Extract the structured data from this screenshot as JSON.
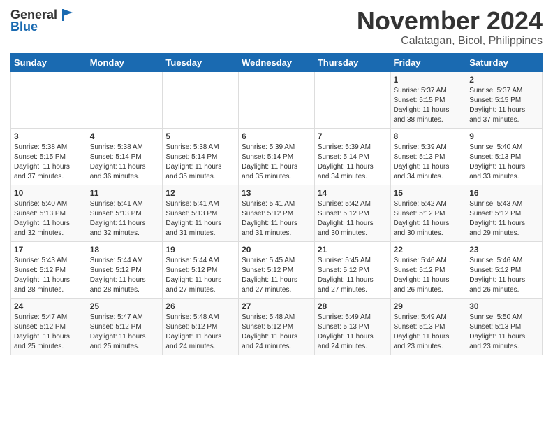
{
  "header": {
    "logo_line1": "General",
    "logo_line2": "Blue",
    "month": "November 2024",
    "location": "Calatagan, Bicol, Philippines"
  },
  "days_of_week": [
    "Sunday",
    "Monday",
    "Tuesday",
    "Wednesday",
    "Thursday",
    "Friday",
    "Saturday"
  ],
  "weeks": [
    [
      {
        "day": "",
        "info": ""
      },
      {
        "day": "",
        "info": ""
      },
      {
        "day": "",
        "info": ""
      },
      {
        "day": "",
        "info": ""
      },
      {
        "day": "",
        "info": ""
      },
      {
        "day": "1",
        "info": "Sunrise: 5:37 AM\nSunset: 5:15 PM\nDaylight: 11 hours\nand 38 minutes."
      },
      {
        "day": "2",
        "info": "Sunrise: 5:37 AM\nSunset: 5:15 PM\nDaylight: 11 hours\nand 37 minutes."
      }
    ],
    [
      {
        "day": "3",
        "info": "Sunrise: 5:38 AM\nSunset: 5:15 PM\nDaylight: 11 hours\nand 37 minutes."
      },
      {
        "day": "4",
        "info": "Sunrise: 5:38 AM\nSunset: 5:14 PM\nDaylight: 11 hours\nand 36 minutes."
      },
      {
        "day": "5",
        "info": "Sunrise: 5:38 AM\nSunset: 5:14 PM\nDaylight: 11 hours\nand 35 minutes."
      },
      {
        "day": "6",
        "info": "Sunrise: 5:39 AM\nSunset: 5:14 PM\nDaylight: 11 hours\nand 35 minutes."
      },
      {
        "day": "7",
        "info": "Sunrise: 5:39 AM\nSunset: 5:14 PM\nDaylight: 11 hours\nand 34 minutes."
      },
      {
        "day": "8",
        "info": "Sunrise: 5:39 AM\nSunset: 5:13 PM\nDaylight: 11 hours\nand 34 minutes."
      },
      {
        "day": "9",
        "info": "Sunrise: 5:40 AM\nSunset: 5:13 PM\nDaylight: 11 hours\nand 33 minutes."
      }
    ],
    [
      {
        "day": "10",
        "info": "Sunrise: 5:40 AM\nSunset: 5:13 PM\nDaylight: 11 hours\nand 32 minutes."
      },
      {
        "day": "11",
        "info": "Sunrise: 5:41 AM\nSunset: 5:13 PM\nDaylight: 11 hours\nand 32 minutes."
      },
      {
        "day": "12",
        "info": "Sunrise: 5:41 AM\nSunset: 5:13 PM\nDaylight: 11 hours\nand 31 minutes."
      },
      {
        "day": "13",
        "info": "Sunrise: 5:41 AM\nSunset: 5:12 PM\nDaylight: 11 hours\nand 31 minutes."
      },
      {
        "day": "14",
        "info": "Sunrise: 5:42 AM\nSunset: 5:12 PM\nDaylight: 11 hours\nand 30 minutes."
      },
      {
        "day": "15",
        "info": "Sunrise: 5:42 AM\nSunset: 5:12 PM\nDaylight: 11 hours\nand 30 minutes."
      },
      {
        "day": "16",
        "info": "Sunrise: 5:43 AM\nSunset: 5:12 PM\nDaylight: 11 hours\nand 29 minutes."
      }
    ],
    [
      {
        "day": "17",
        "info": "Sunrise: 5:43 AM\nSunset: 5:12 PM\nDaylight: 11 hours\nand 28 minutes."
      },
      {
        "day": "18",
        "info": "Sunrise: 5:44 AM\nSunset: 5:12 PM\nDaylight: 11 hours\nand 28 minutes."
      },
      {
        "day": "19",
        "info": "Sunrise: 5:44 AM\nSunset: 5:12 PM\nDaylight: 11 hours\nand 27 minutes."
      },
      {
        "day": "20",
        "info": "Sunrise: 5:45 AM\nSunset: 5:12 PM\nDaylight: 11 hours\nand 27 minutes."
      },
      {
        "day": "21",
        "info": "Sunrise: 5:45 AM\nSunset: 5:12 PM\nDaylight: 11 hours\nand 27 minutes."
      },
      {
        "day": "22",
        "info": "Sunrise: 5:46 AM\nSunset: 5:12 PM\nDaylight: 11 hours\nand 26 minutes."
      },
      {
        "day": "23",
        "info": "Sunrise: 5:46 AM\nSunset: 5:12 PM\nDaylight: 11 hours\nand 26 minutes."
      }
    ],
    [
      {
        "day": "24",
        "info": "Sunrise: 5:47 AM\nSunset: 5:12 PM\nDaylight: 11 hours\nand 25 minutes."
      },
      {
        "day": "25",
        "info": "Sunrise: 5:47 AM\nSunset: 5:12 PM\nDaylight: 11 hours\nand 25 minutes."
      },
      {
        "day": "26",
        "info": "Sunrise: 5:48 AM\nSunset: 5:12 PM\nDaylight: 11 hours\nand 24 minutes."
      },
      {
        "day": "27",
        "info": "Sunrise: 5:48 AM\nSunset: 5:12 PM\nDaylight: 11 hours\nand 24 minutes."
      },
      {
        "day": "28",
        "info": "Sunrise: 5:49 AM\nSunset: 5:13 PM\nDaylight: 11 hours\nand 24 minutes."
      },
      {
        "day": "29",
        "info": "Sunrise: 5:49 AM\nSunset: 5:13 PM\nDaylight: 11 hours\nand 23 minutes."
      },
      {
        "day": "30",
        "info": "Sunrise: 5:50 AM\nSunset: 5:13 PM\nDaylight: 11 hours\nand 23 minutes."
      }
    ]
  ]
}
